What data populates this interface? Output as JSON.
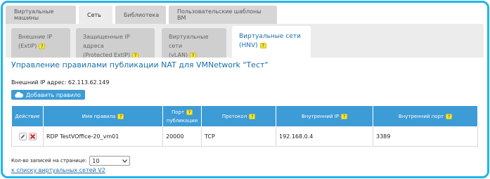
{
  "top_tabs": [
    {
      "label": "Виртуальные машины"
    },
    {
      "label": "Сеть"
    },
    {
      "label": "Библиотека"
    },
    {
      "label": "Пользовательские шаблоны ВМ"
    }
  ],
  "subtabs": [
    {
      "line1": "Внешние IP",
      "line2": "(ExtIP)"
    },
    {
      "line1": "Защищенные IP адреса",
      "line2": "(Protected ExtIP)"
    },
    {
      "line1": "Виртуальные сети",
      "line2": "(vLAN)"
    },
    {
      "line1": "Виртуальные сети",
      "line2": "(HNV)"
    }
  ],
  "help_glyph": "?",
  "page_title": "Управление правилами публикации NAT для VMNetwork \"Тест\"",
  "external_ip": "Внешний IP адрес: 62.113.62.149",
  "add_rule_label": "Добавить правило",
  "table": {
    "headers": {
      "action": "Действие",
      "rule_name": "Имя правила",
      "publish_port_1": "Порт",
      "publish_port_2": "публикации",
      "protocol": "Протокол",
      "internal_ip": "Внутренний IP",
      "internal_port": "Внутренний порт"
    },
    "rows": [
      {
        "rule_name": "RDP TestVOffice-20_vm01",
        "publish_port": "20000",
        "protocol": "TCP",
        "internal_ip": "192.168.0.4",
        "internal_port": "3389"
      }
    ]
  },
  "pager": {
    "label": "Кол-во записей на странице:",
    "value": "10"
  },
  "back_link": "к списку виртуальных сетей V2",
  "colors": {
    "accent": "#3d9bd6",
    "frame": "#23b5e6",
    "help": "#f2e53d",
    "delete": "#d9261c"
  },
  "icons": {
    "add": "cloud-icon",
    "edit": "pencil-icon",
    "delete": "delete-x-icon",
    "dropdown": "chevron-down-icon"
  }
}
